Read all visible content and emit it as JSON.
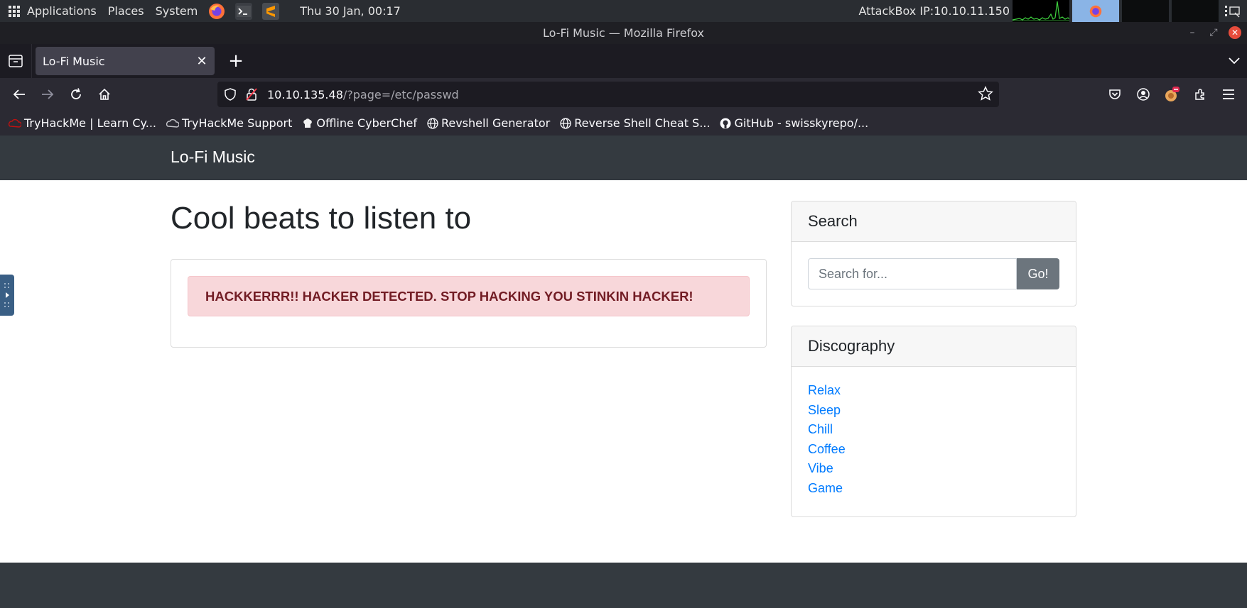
{
  "os_panel": {
    "apps_icon": "grid-icon",
    "menus": [
      "Applications",
      "Places",
      "System"
    ],
    "launchers": [
      "firefox-icon",
      "terminal-icon",
      "sublime-text-icon"
    ],
    "clock": "Thu 30 Jan, 00:17",
    "ip_label": "AttackBox IP:10.10.11.150"
  },
  "window": {
    "title": "Lo-Fi Music — Mozilla Firefox"
  },
  "tabs": [
    {
      "label": "Lo-Fi Music",
      "active": true
    }
  ],
  "nav": {
    "url_host": "10.10.135.48",
    "url_path": "/?page=/etc/passwd"
  },
  "bookmarks": [
    {
      "label": "TryHackMe | Learn Cy...",
      "icon": "tryhackme-icon"
    },
    {
      "label": "TryHackMe Support",
      "icon": "cloud-icon"
    },
    {
      "label": "Offline CyberChef",
      "icon": "chef-icon"
    },
    {
      "label": "Revshell Generator",
      "icon": "globe-icon"
    },
    {
      "label": "Reverse Shell Cheat S...",
      "icon": "globe-icon"
    },
    {
      "label": "GitHub - swisskyrepo/...",
      "icon": "github-icon"
    }
  ],
  "page": {
    "brand": "Lo-Fi Music",
    "heading": "Cool beats to listen to",
    "alert": "HACKKERRR!! HACKER DETECTED. STOP HACKING YOU STINKIN HACKER!",
    "search": {
      "title": "Search",
      "placeholder": "Search for...",
      "button": "Go!"
    },
    "discography": {
      "title": "Discography",
      "items": [
        "Relax",
        "Sleep",
        "Chill",
        "Coffee",
        "Vibe",
        "Game"
      ]
    }
  },
  "colors": {
    "navbar": "#343a40",
    "alert_bg": "#f8d7da",
    "alert_text": "#721c24",
    "link": "#007bff",
    "button": "#6c757d"
  }
}
